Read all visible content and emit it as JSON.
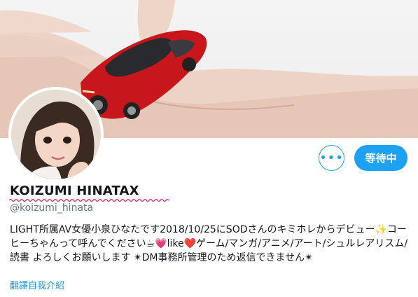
{
  "profile": {
    "display_name": "KOIZUMI HINATAX",
    "handle": "@koizumi_hinata",
    "bio": "LIGHT所属AV女優小泉ひなたです2018/10/25にSODさんのキミホレからデビュー✨コーヒーちゃんって呼んでください☕💗like❤️ゲーム/マンガ/アニメ/アート/シュルレアリスム/読書 よろしくお願いします ✴︎DM事務所管理のため返信できません✴︎",
    "translate_link": "翻譯自我介紹"
  },
  "actions": {
    "more_label": "•••",
    "pending_label": "等待中"
  },
  "colors": {
    "accent": "#1da1f2",
    "text": "#14171a",
    "secondary": "#657786",
    "spellcheck_underline": "#e0245e"
  },
  "icons": {
    "more": "more-icon"
  }
}
